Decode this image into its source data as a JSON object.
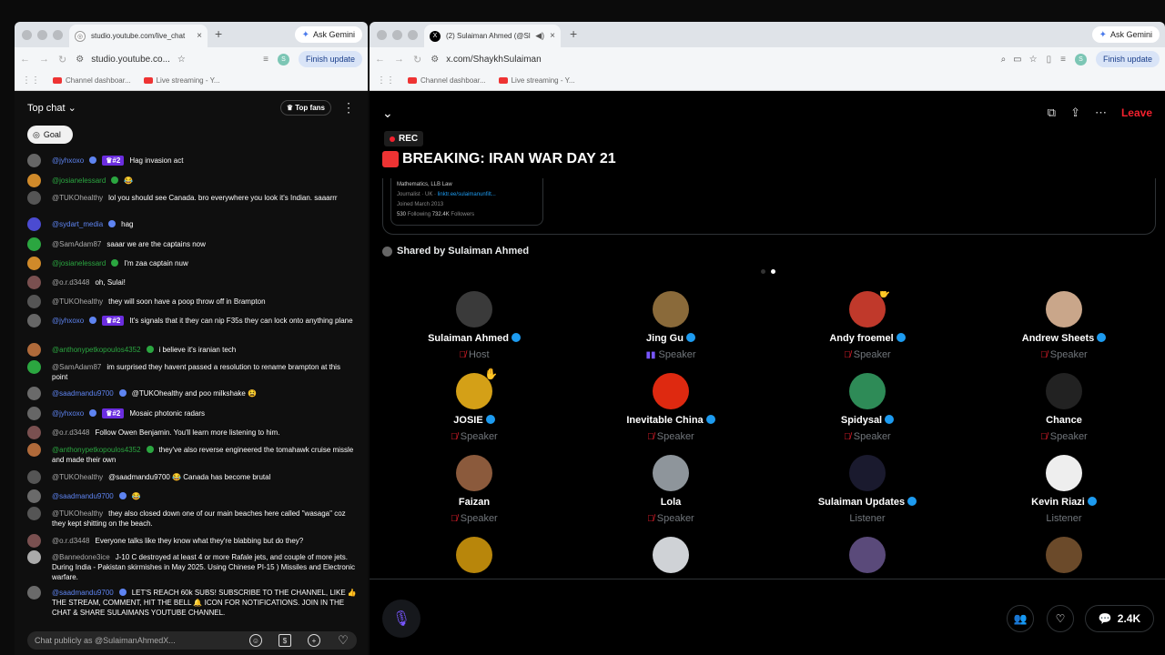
{
  "colors": {
    "youtube_red": "#ff0000",
    "x_red": "#f4212e",
    "x_blue": "#1d9bf0",
    "purple": "#7856ff"
  },
  "left_browser": {
    "tab_title": "studio.youtube.com/live_chat",
    "new_tab": "+",
    "gemini": "Ask Gemini",
    "url": "studio.youtube.co...",
    "profile": "S",
    "finish_update": "Finish update",
    "bookmarks": [
      "Channel dashboar...",
      "Live streaming - Y..."
    ]
  },
  "chat": {
    "title": "Top chat",
    "top_fans": "Top fans",
    "goal": "Goal",
    "input_placeholder": "Chat publicly as @SulaimanAhmedX...",
    "messages": [
      {
        "user": "@jyhxoxo",
        "rank": "#2",
        "text": "Hag invasion act"
      },
      {
        "user": "@josianelessard",
        "text": "😂"
      },
      {
        "user": "@TUKOhealthy",
        "text": "lol you should see Canada. bro everywhere you look it's Indian. saaarrr"
      },
      {
        "user": "@sydart_media",
        "text": "hag"
      },
      {
        "user": "@SamAdam87",
        "text": "saaar we are the captains now"
      },
      {
        "user": "@josianelessard",
        "text": "I'm zaa captain nuw"
      },
      {
        "user": "@o.r.d3448",
        "text": "oh, Sulai!"
      },
      {
        "user": "@TUKOhealthy",
        "text": "they will soon have a poop throw off in Brampton"
      },
      {
        "user": "@jyhxoxo",
        "rank": "#2",
        "text": "It's signals that it they can nip F35s they can lock onto anything plane"
      },
      {
        "user": "@anthonypetkopoulos4352",
        "text": "i believe it's iranian tech"
      },
      {
        "user": "@SamAdam87",
        "text": "im surprised they havent passed a resolution to rename brampton at this point"
      },
      {
        "user": "@saadmandu9700",
        "text": "@TUKOhealthy and poo milkshake 😫"
      },
      {
        "user": "@jyhxoxo",
        "rank": "#2",
        "text": "Mosaic photonic radars"
      },
      {
        "user": "@o.r.d3448",
        "text": "Follow Owen Benjamin. You'll learn more listening to him."
      },
      {
        "user": "@anthonypetkopoulos4352",
        "text": "they've also reverse engineered the tomahawk cruise missle and made their own"
      },
      {
        "user": "@TUKOhealthy",
        "text": "@saadmandu9700 😂 Canada has become brutal"
      },
      {
        "user": "@saadmandu9700",
        "text": "😂"
      },
      {
        "user": "@TUKOhealthy",
        "text": "they also closed down one of our main beaches here called \"wasaga\" coz they kept shitting on the beach."
      },
      {
        "user": "@o.r.d3448",
        "text": "Everyone talks like they know what they're blabbing but do they?"
      },
      {
        "user": "@Bannedone3ice",
        "text": "J-10 C destroyed at least 4 or more Rafale jets, and couple of more jets. During India - Pakistan skirmishes in May 2025. Using Chinese PI-15 ) Missiles and Electronic warfare."
      },
      {
        "user": "@saadmandu9700",
        "text": "LET'S REACH 60k SUBS! SUBSCRIBE TO THE CHANNEL, LIKE 👍 THE STREAM, COMMENT, HIT THE BELL 🔔 ICON FOR NOTIFICATIONS. JOIN IN THE CHAT & SHARE SULAIMANS YOUTUBE CHANNEL."
      }
    ]
  },
  "right_browser": {
    "tab_title": "(2) Sulaiman Ahmed (@Sl",
    "new_tab": "+",
    "gemini": "Ask Gemini",
    "url": "x.com/ShaykhSulaiman",
    "profile": "S",
    "finish_update": "Finish update",
    "bookmarks": [
      "Channel dashboar...",
      "Live streaming - Y..."
    ]
  },
  "space": {
    "leave": "Leave",
    "rec": "REC",
    "title": "BREAKING: IRAN WAR DAY 21",
    "card_lines": [
      "Mathematics, LLB Law",
      "Journalist",
      "UK",
      "linktr.ee/sulaimanunfilt...",
      "Joined March 2013",
      "530",
      "Following",
      "732.4K",
      "Followers"
    ],
    "shared_by": "Shared by Sulaiman Ahmed",
    "comments_count": "2.4K",
    "participants": [
      {
        "name": "Sulaiman Ahmed",
        "role": "Host",
        "verified": true,
        "muted": true,
        "color": "#3a3a3a"
      },
      {
        "name": "Jing Gu",
        "role": "Speaker",
        "verified": true,
        "talking": true,
        "color": "#8a6a3a"
      },
      {
        "name": "Andy froemel",
        "role": "Speaker",
        "verified": true,
        "muted": true,
        "color": "#c0392b",
        "hand": true
      },
      {
        "name": "Andrew Sheets",
        "role": "Speaker",
        "verified": true,
        "muted": true,
        "color": "#c9a68a"
      },
      {
        "name": "JOSIE",
        "role": "Speaker",
        "verified": true,
        "muted": true,
        "color": "#d4a017",
        "hand": true
      },
      {
        "name": "Inevitable China",
        "role": "Speaker",
        "verified": true,
        "muted": true,
        "color": "#de2910"
      },
      {
        "name": "Spidysal",
        "role": "Speaker",
        "verified": true,
        "muted": true,
        "color": "#2e8b57"
      },
      {
        "name": "Chance",
        "role": "Speaker",
        "verified": false,
        "muted": true,
        "color": "#222222"
      },
      {
        "name": "Faizan",
        "role": "Speaker",
        "verified": false,
        "muted": true,
        "color": "#8b5a3c"
      },
      {
        "name": "Lola",
        "role": "Speaker",
        "verified": false,
        "muted": true,
        "color": "#8e959b"
      },
      {
        "name": "Sulaiman Updates",
        "role": "Listener",
        "verified": true,
        "color": "#1a1a2e"
      },
      {
        "name": "Kevin Riazi",
        "role": "Listener",
        "verified": true,
        "color": "#eeeeee"
      },
      {
        "name": "",
        "role": "",
        "color": "#b8860b"
      },
      {
        "name": "",
        "role": "",
        "color": "#cfd2d6"
      },
      {
        "name": "",
        "role": "",
        "color": "#5a4a7a"
      },
      {
        "name": "",
        "role": "",
        "color": "#6b4a2a"
      }
    ]
  }
}
